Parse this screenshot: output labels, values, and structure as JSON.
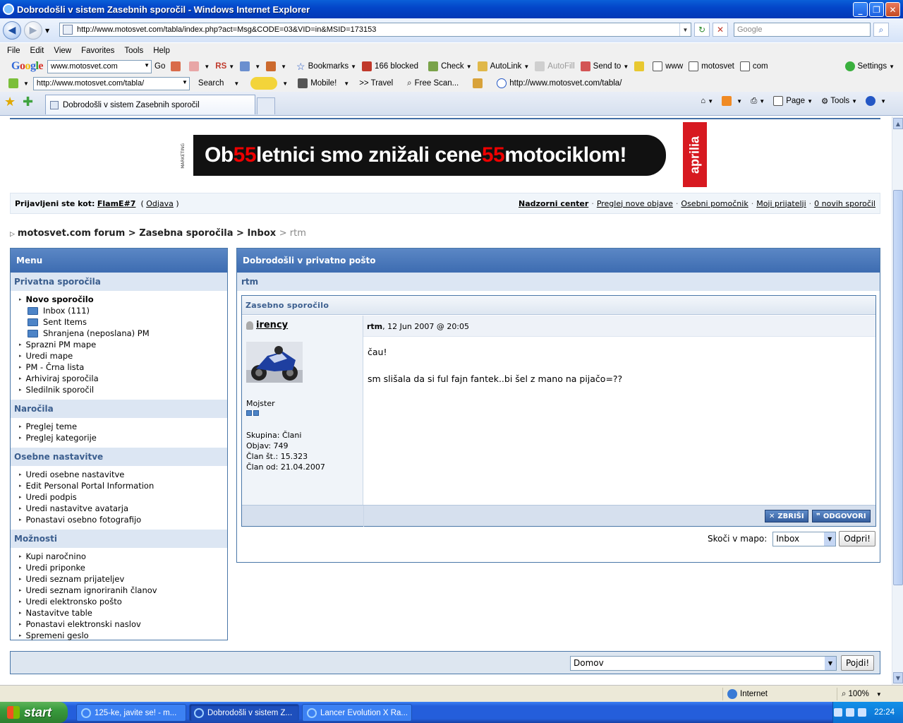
{
  "window": {
    "title": "Dobrodošli v sistem Zasebnih sporočil - Windows Internet Explorer"
  },
  "address": {
    "url": "http://www.motosvet.com/tabla/index.php?act=Msg&CODE=03&VID=in&MSID=173153",
    "search_placeholder": "Google"
  },
  "menubar": [
    "File",
    "Edit",
    "View",
    "Favorites",
    "Tools",
    "Help"
  ],
  "google_toolbar": {
    "logo": "Google",
    "search_value": "www.motosvet.com",
    "go": "Go",
    "rs": "RS",
    "bookmarks": "Bookmarks",
    "blocked": "166 blocked",
    "check": "Check",
    "autolink": "AutoLink",
    "autofill": "AutoFill",
    "sendto": "Send to",
    "www": "www",
    "motosvet": "motosvet",
    "com": "com",
    "settings": "Settings"
  },
  "toolbar2": {
    "url": "http://www.motosvet.com/tabla/",
    "search": "Search",
    "mobile": "Mobile!",
    "travel": ">> Travel",
    "freescan": "Free Scan...",
    "link_url": "http://www.motosvet.com/tabla/"
  },
  "tab": {
    "title": "Dobrodošli v sistem Zasebnih sporočil"
  },
  "commandbar": {
    "page": "Page",
    "tools": "Tools"
  },
  "banner": {
    "marketing": "MARKETING",
    "part1": "Ob ",
    "num1": "55",
    "part2": " letnici smo znižali cene ",
    "num2": "55",
    "part3": " motociklom!",
    "brand": "aprilia"
  },
  "userbar": {
    "logged_as": "Prijavljeni ste kot:",
    "user": "FlamE#7",
    "logout": "Odjava",
    "links": [
      "Nadzorni center",
      "Preglej nove objave",
      "Osebni pomočnik",
      "Moji prijatelji",
      "0 novih sporočil"
    ]
  },
  "breadcrumb": {
    "items": [
      "motosvet.com forum",
      "Zasebna sporočila",
      "Inbox"
    ],
    "current": "rtm"
  },
  "menu": {
    "title": "Menu",
    "sections": [
      {
        "title": "Privatna sporočila",
        "items": [
          "Novo sporočilo",
          "Inbox (111)",
          "Sent Items",
          "Shranjena (neposlana) PM",
          "Sprazni PM mape",
          "Uredi mape",
          "PM - Črna lista",
          "Arhiviraj sporočila",
          "Sledilnik sporočil"
        ]
      },
      {
        "title": "Naročila",
        "items": [
          "Preglej teme",
          "Preglej kategorije"
        ]
      },
      {
        "title": "Osebne nastavitve",
        "items": [
          "Uredi osebne nastavitve",
          "Edit Personal Portal Information",
          "Uredi podpis",
          "Uredi nastavitve avatarja",
          "Ponastavi osebno fotografijo"
        ]
      },
      {
        "title": "Možnosti",
        "items": [
          "Kupi naročnino",
          "Uredi priponke",
          "Uredi seznam prijateljev",
          "Uredi seznam ignoriranih članov",
          "Uredi elektronsko pošto",
          "Nastavitve table",
          "Ponastavi elektronski naslov",
          "Spremeni geslo"
        ]
      }
    ]
  },
  "main": {
    "title": "Dobrodošli v privatno pošto",
    "subtitle": "rtm",
    "box_title": "Zasebno sporočilo",
    "author": "irency",
    "meta_title": "rtm",
    "meta_date": ", 12 Jun 2007 @ 20:05",
    "rank": "Mojster",
    "stats": [
      "Skupina: Člani",
      "Objav: 749",
      "Član št.: 15.323",
      "Član od: 21.04.2007"
    ],
    "body_line1": "čau!",
    "body_line2": "sm slišala da si ful fajn fantek..bi šel z mano na pijačo=??",
    "delete": "ZBRIŠI",
    "reply": "ODGOVORI",
    "jump_label": "Skoči v mapo:",
    "jump_value": "Inbox",
    "jump_btn": "Odpri!"
  },
  "bottom": {
    "select": "Domov",
    "btn": "Pojdi!"
  },
  "status": {
    "zone": "Internet",
    "zoom": "100%"
  },
  "taskbar": {
    "start": "start",
    "items": [
      "125-ke, javite se! - m...",
      "Dobrodošli v sistem Z...",
      "Lancer Evolution X Ra..."
    ],
    "clock": "22:24"
  },
  "colors": {
    "header_blue": "#3d6cb1",
    "section_bg": "#dce6f3",
    "banner_red": "#e00000"
  }
}
